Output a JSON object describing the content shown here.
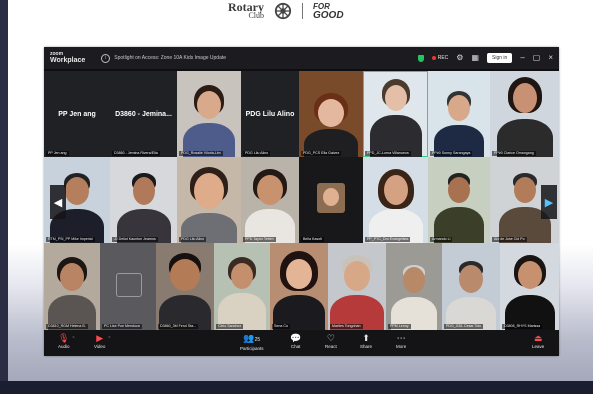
{
  "slide": {
    "logo_rotary": "Rotary",
    "logo_club": "Club",
    "logo_for": "FOR",
    "logo_good": "GOOD"
  },
  "titlebar": {
    "brand_small": "zoom",
    "brand_name": "Workplace",
    "meeting_title": "Spotlight on Access: Zone 10A Kids Image Update",
    "rec_label": "REC",
    "signin_label": "Sign in"
  },
  "participants": [
    {
      "name": "PP Jen ang",
      "big": "PP Jen ang"
    },
    {
      "name": "D3860 - Jemina Rivera/Ella",
      "big": "D3860 - Jemina..."
    },
    {
      "name": "PDG_Rosalie Viloria-Lim",
      "big": ""
    },
    {
      "name": "PDG Lilu Alino",
      "big": "PDG Lilu Alino"
    },
    {
      "name": "PDG_PCS Ella Galvez",
      "big": ""
    },
    {
      "name": "PPD_JC-Lorna Villanueva",
      "big": ""
    },
    {
      "name": "PP#0 Sonny Sarangaya",
      "big": ""
    },
    {
      "name": "PP#0 Clarice Omangang",
      "big": ""
    },
    {
      "name": "RTM_PSI_PP Mike Imperial",
      "big": ""
    },
    {
      "name": "JJ Deliot Kaunton Jeamos",
      "big": ""
    },
    {
      "name": "PDG Lilu Alino",
      "big": ""
    },
    {
      "name": "PPD Taylor Tetteh",
      "big": ""
    },
    {
      "name": "Bella Kasoti",
      "big": ""
    },
    {
      "name": "PP_PTC_Dru Evangelista",
      "big": ""
    },
    {
      "name": "Armando Li",
      "big": ""
    },
    {
      "name": "Alo de Jose Cid Po",
      "big": ""
    },
    {
      "name": "D3810_RGM Helena B.",
      "big": ""
    },
    {
      "name": "PC Lise Poe Mendoza",
      "big": ""
    },
    {
      "name": "D3860_3M Ferol Sta...",
      "big": ""
    },
    {
      "name": "Cielo Sanchez",
      "big": ""
    },
    {
      "name": "Sena Co",
      "big": ""
    },
    {
      "name": "Marites Tongohan",
      "big": ""
    },
    {
      "name": "PPM Lenny",
      "big": ""
    },
    {
      "name": "PDG_GDL Cesar Tolo",
      "big": ""
    },
    {
      "name": "D3806_RHYS Marissa",
      "big": ""
    }
  ],
  "toolbar": {
    "audio": "Audio",
    "video": "Video",
    "participants": "Participants",
    "participants_count": "25",
    "chat": "Chat",
    "react": "React",
    "share": "Share",
    "more": "More",
    "leave": "Leave"
  },
  "colors": {
    "window_bg": "#0f0f11",
    "toolbar_bg": "#141417",
    "active_speaker": "#35d07f",
    "mute_red": "#ff4a4a"
  }
}
